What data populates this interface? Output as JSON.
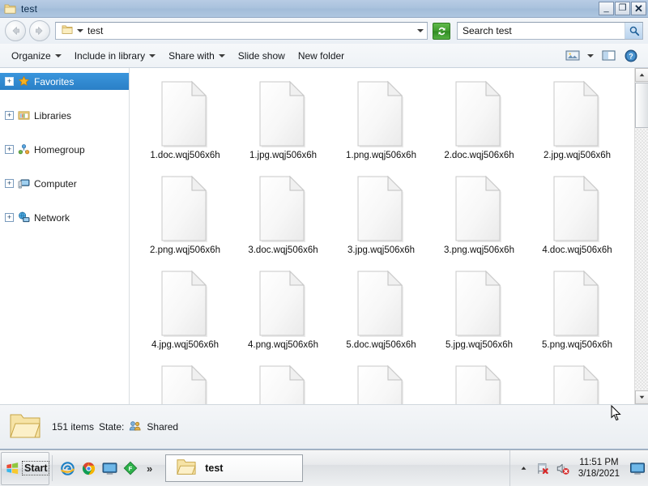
{
  "window": {
    "title": "test",
    "title_icon": "folder-icon",
    "controls": {
      "minimize": "_",
      "maximize": "❐",
      "close": "✕"
    }
  },
  "navigation": {
    "back_label": "Back",
    "forward_label": "Forward",
    "address_crumb": "test",
    "address_icon": "folder-icon",
    "refresh_label": "Refresh",
    "search": {
      "value": "Search test",
      "placeholder": "Search test"
    }
  },
  "toolbar": {
    "items": [
      {
        "label": "Organize",
        "has_caret": true
      },
      {
        "label": "Include in library",
        "has_caret": true
      },
      {
        "label": "Share with",
        "has_caret": true
      },
      {
        "label": "Slide show",
        "has_caret": false
      },
      {
        "label": "New folder",
        "has_caret": false
      }
    ],
    "right_icons": [
      {
        "name": "change-view-icon"
      },
      {
        "name": "view-caret-down-icon"
      },
      {
        "name": "preview-pane-icon"
      },
      {
        "name": "help-icon"
      }
    ]
  },
  "sidebar": {
    "items": [
      {
        "label": "Favorites",
        "icon": "star-icon",
        "selected": true
      },
      {
        "label": "Libraries",
        "icon": "libraries-icon",
        "selected": false
      },
      {
        "label": "Homegroup",
        "icon": "homegroup-icon",
        "selected": false
      },
      {
        "label": "Computer",
        "icon": "computer-icon",
        "selected": false
      },
      {
        "label": "Network",
        "icon": "network-icon",
        "selected": false
      }
    ],
    "expander_glyph": "+"
  },
  "files": [
    {
      "name": "1.doc.wqj506x6h"
    },
    {
      "name": "1.jpg.wqj506x6h"
    },
    {
      "name": "1.png.wqj506x6h"
    },
    {
      "name": "2.doc.wqj506x6h"
    },
    {
      "name": "2.jpg.wqj506x6h"
    },
    {
      "name": "2.png.wqj506x6h"
    },
    {
      "name": "3.doc.wqj506x6h"
    },
    {
      "name": "3.jpg.wqj506x6h"
    },
    {
      "name": "3.png.wqj506x6h"
    },
    {
      "name": "4.doc.wqj506x6h"
    },
    {
      "name": "4.jpg.wqj506x6h"
    },
    {
      "name": "4.png.wqj506x6h"
    },
    {
      "name": "5.doc.wqj506x6h"
    },
    {
      "name": "5.jpg.wqj506x6h"
    },
    {
      "name": "5.png.wqj506x6h"
    },
    {
      "name": ""
    },
    {
      "name": ""
    },
    {
      "name": ""
    },
    {
      "name": ""
    },
    {
      "name": ""
    }
  ],
  "statusbar": {
    "folder_icon": "open-folder-icon",
    "item_count": "151 items",
    "state_label": "State:",
    "state_icon": "shared-users-icon",
    "state_value": "Shared"
  },
  "taskbar": {
    "start_label": "Start",
    "quick_launch": [
      {
        "name": "internet-explorer-icon"
      },
      {
        "name": "chrome-icon"
      },
      {
        "name": "show-desktop-media-icon"
      },
      {
        "name": "green-diamond-f-icon"
      }
    ],
    "overflow_glyph": "»",
    "task_button": {
      "label": "test",
      "icon": "folder-icon"
    },
    "tray": {
      "overflow_glyph": "⌃",
      "icons": [
        {
          "name": "action-center-flag-error-icon"
        },
        {
          "name": "volume-muted-icon"
        }
      ],
      "time": "11:51 PM",
      "date": "3/18/2021",
      "show_desktop": "show-desktop-icon"
    }
  },
  "colors": {
    "titlebar": "#a9c2dd",
    "selection": "#3a96dd",
    "refresh_green": "#3f9a2e",
    "folder_yellow": "#f5dd9a"
  }
}
